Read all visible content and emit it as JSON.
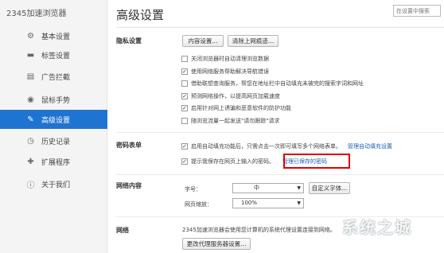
{
  "sidebar": {
    "app_title": "2345加速浏览器",
    "items": [
      {
        "label": "基本设置",
        "icon": "gear-icon"
      },
      {
        "label": "标签设置",
        "icon": "tab-icon"
      },
      {
        "label": "广告拦截",
        "icon": "ad-block-icon"
      },
      {
        "label": "鼠标手势",
        "icon": "mouse-icon"
      },
      {
        "label": "高级设置",
        "icon": "wrench-icon",
        "active": true
      },
      {
        "label": "历史记录",
        "icon": "clock-icon"
      },
      {
        "label": "扩展程序",
        "icon": "puzzle-icon"
      },
      {
        "label": "关于我们",
        "icon": "info-icon"
      }
    ]
  },
  "header": {
    "title": "高级设置",
    "search_placeholder": "在设置中搜索"
  },
  "privacy": {
    "label": "隐私设置",
    "content_settings_btn": "内容设置...",
    "clear_data_btn": "清除上网痕迹...",
    "options": [
      {
        "text": "关闭浏览器时自动清理浏览数据",
        "checked": false
      },
      {
        "text": "使用网络服务帮助解决导航错误",
        "checked": true
      },
      {
        "text": "借助联想查询服务，帮您在地址栏中自动填充未被完的搜索字词和网址",
        "checked": false
      },
      {
        "text": "预测网络操作，以提高网页加载速度",
        "checked": true
      },
      {
        "text": "启用针对网上诱骗和恶意软件的防护功能",
        "checked": true
      },
      {
        "text": "随浏览流量一起发送\"请勿跟踪\"请求",
        "checked": false
      }
    ]
  },
  "passwords": {
    "label": "密码表单",
    "autofill_text": "启用自动填充功能后，只需点击一次即可填写多个网络表单。",
    "autofill_link": "管理自动填充设置",
    "save_text": "提示我保存在网页上输入的密码。",
    "save_link": "管理已保存的密码",
    "autofill_checked": true,
    "save_checked": true
  },
  "web_content": {
    "label": "网络内容",
    "font_size_label": "字号：",
    "font_size_value": "中",
    "custom_fonts_btn": "自定义字体...",
    "zoom_label": "网页缩放：",
    "zoom_value": "100%"
  },
  "network": {
    "label": "网络",
    "proxy_text": "2345加速浏览器会使用您计算机的系统代理设置连接到网络。",
    "proxy_btn": "更改代理服务器设置..."
  },
  "watermark": "系统之城"
}
